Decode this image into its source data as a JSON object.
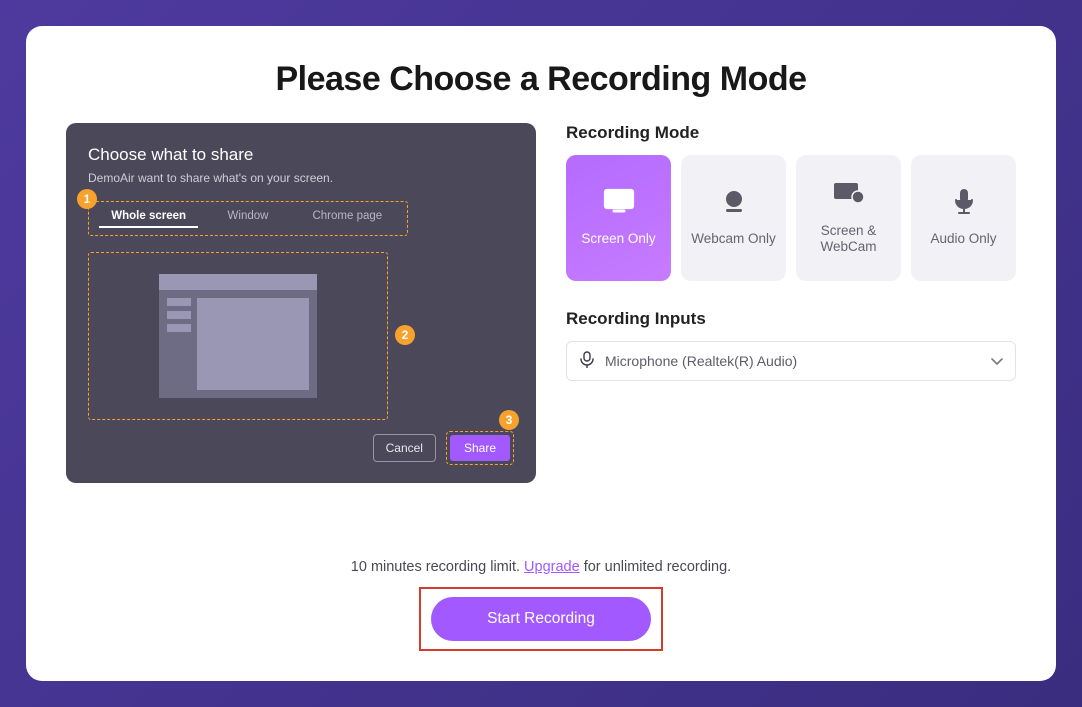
{
  "title": "Please Choose a Recording Mode",
  "share_dialog": {
    "heading": "Choose what to share",
    "subtext": "DemoAir want to share what's on your screen.",
    "tabs": [
      "Whole screen",
      "Window",
      "Chrome page"
    ],
    "active_tab_index": 0,
    "cancel_label": "Cancel",
    "share_label": "Share",
    "badges": {
      "one": "1",
      "two": "2",
      "three": "3"
    }
  },
  "recording_mode": {
    "section_label": "Recording Mode",
    "options": [
      {
        "label": "Screen Only",
        "icon": "monitor"
      },
      {
        "label": "Webcam Only",
        "icon": "webcam"
      },
      {
        "label": "Screen & WebCam",
        "icon": "screen-webcam"
      },
      {
        "label": "Audio Only",
        "icon": "mic"
      }
    ],
    "active_index": 0
  },
  "recording_inputs": {
    "section_label": "Recording Inputs",
    "selected": "Microphone (Realtek(R) Audio)"
  },
  "footer": {
    "limit_prefix": "10 minutes recording limit. ",
    "upgrade_label": "Upgrade",
    "limit_suffix": " for unlimited recording.",
    "start_label": "Start Recording"
  }
}
